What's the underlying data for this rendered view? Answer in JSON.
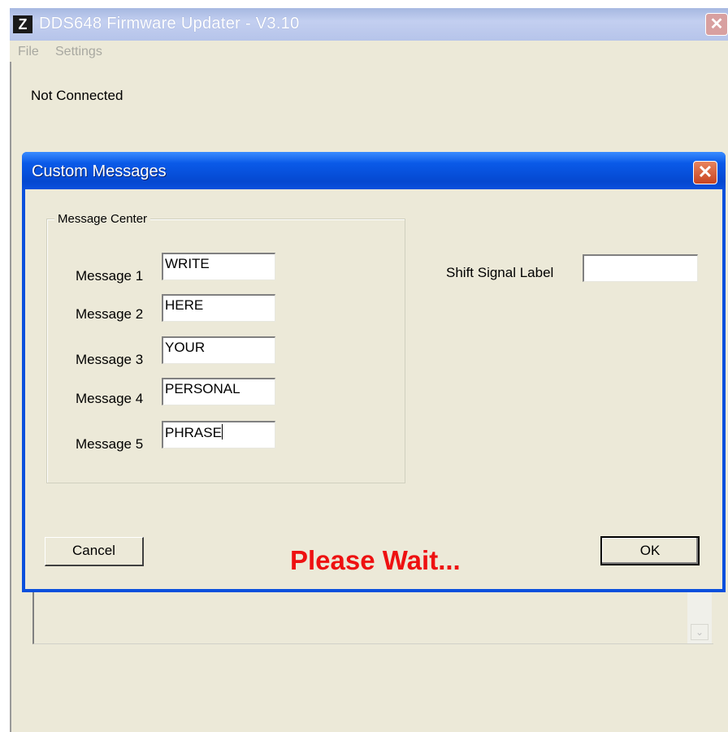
{
  "app": {
    "title": "DDS648 Firmware Updater - V3.10",
    "icon_letter": "Z",
    "close_glyph": "✕"
  },
  "menu": {
    "items": [
      {
        "label": "File"
      },
      {
        "label": "Settings"
      }
    ]
  },
  "status": {
    "connection": "Not Connected"
  },
  "dialog": {
    "title": "Custom Messages",
    "close_glyph": "✕",
    "group_title": "Message Center",
    "messages": [
      {
        "label": "Message 1",
        "value": "WRITE"
      },
      {
        "label": "Message 2",
        "value": "HERE"
      },
      {
        "label": "Message 3",
        "value": "YOUR"
      },
      {
        "label": "Message 4",
        "value": "PERSONAL"
      },
      {
        "label": "Message 5",
        "value": "PHRASE"
      }
    ],
    "shift_signal_label": "Shift Signal Label",
    "shift_signal_value": "",
    "cancel_label": "Cancel",
    "ok_label": "OK",
    "wait_text": "Please Wait..."
  },
  "log": {
    "scroll_down_glyph": "⌄"
  },
  "colors": {
    "dialog_titlebar": "#0a50dd",
    "window_face": "#ece9d8",
    "wait_text": "#ee1111"
  },
  "icons": [
    "app-logo-icon",
    "close-icon",
    "scroll-down-arrow-icon"
  ]
}
